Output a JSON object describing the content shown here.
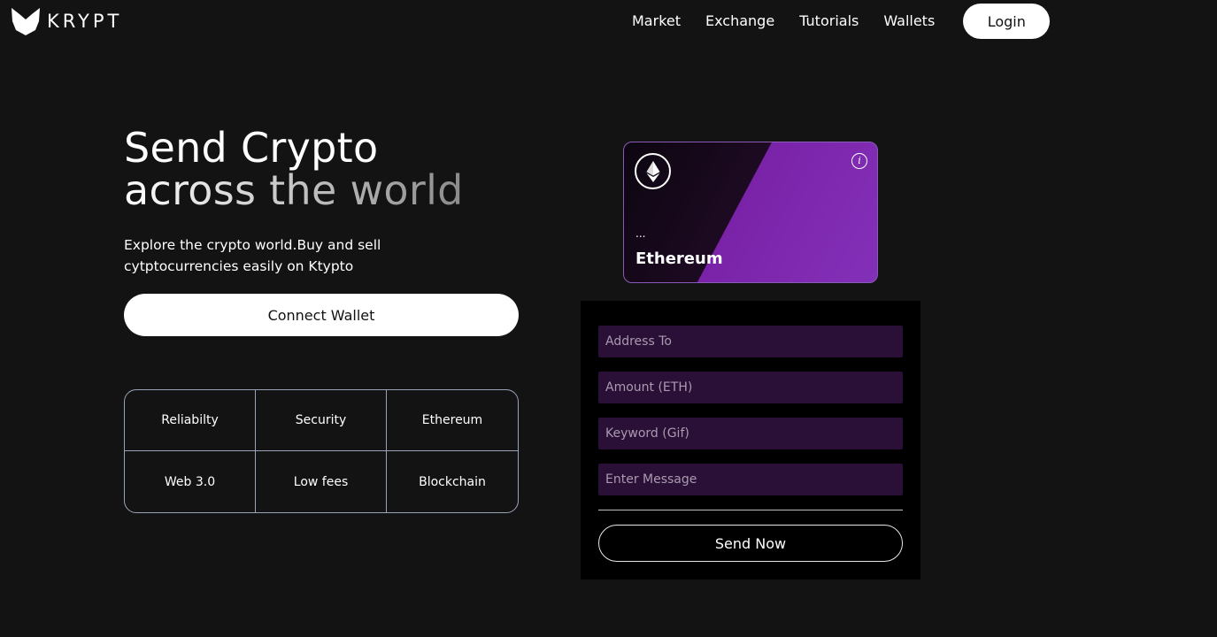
{
  "brand": {
    "name": "KRYPT"
  },
  "nav": {
    "links": [
      "Market",
      "Exchange",
      "Tutorials",
      "Wallets"
    ],
    "login_label": "Login"
  },
  "hero": {
    "title_line1": "Send Crypto",
    "title_line2": "across the world",
    "subtitle": "Explore the crypto world.Buy and sell cytptocurrencies easily on Ktypto",
    "connect_label": "Connect Wallet"
  },
  "features": [
    "Reliabilty",
    "Security",
    "Ethereum",
    "Web 3.0",
    "Low fees",
    "Blockchain"
  ],
  "card": {
    "address": "...",
    "network": "Ethereum"
  },
  "form": {
    "address_placeholder": "Address To",
    "amount_placeholder": "Amount (ETH)",
    "keyword_placeholder": "Keyword (Gif)",
    "message_placeholder": "Enter Message",
    "send_label": "Send Now"
  },
  "colors": {
    "background": "#131313",
    "accent": "#7a23a9",
    "input_bg": "#2a0f36"
  }
}
